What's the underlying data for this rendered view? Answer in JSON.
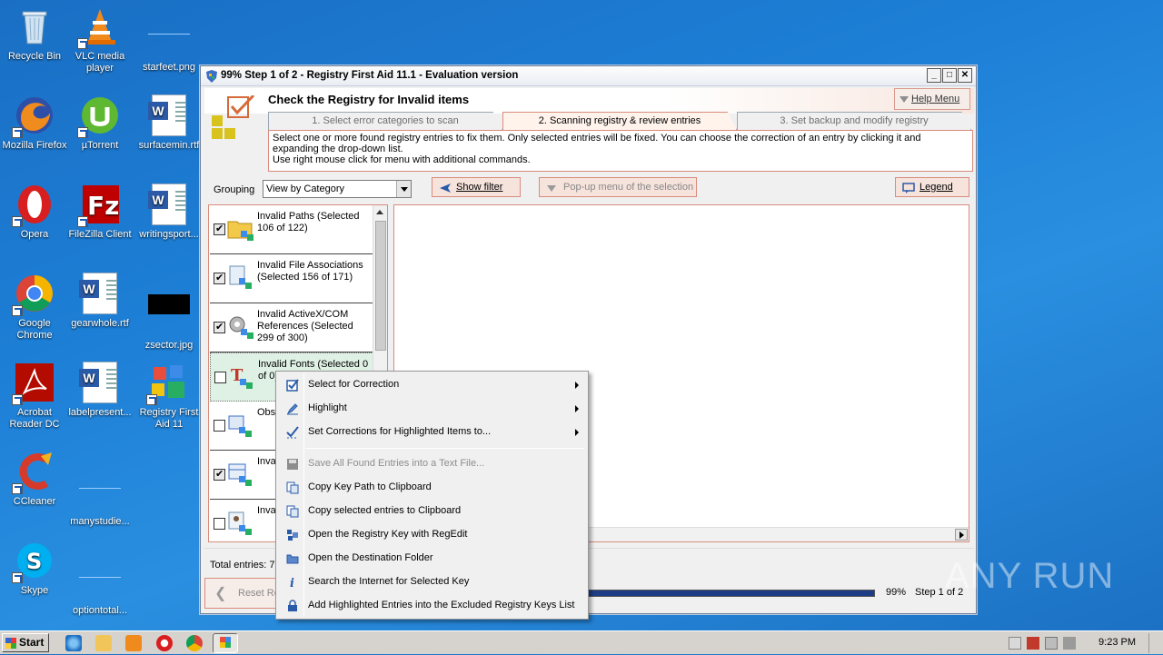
{
  "desktop": {
    "icons": [
      {
        "label": "Recycle Bin"
      },
      {
        "label": "VLC media player"
      },
      {
        "label": "starfeet.png"
      },
      {
        "label": "Mozilla Firefox"
      },
      {
        "label": "µTorrent"
      },
      {
        "label": "surfacemin.rtf"
      },
      {
        "label": "Opera"
      },
      {
        "label": "FileZilla Client"
      },
      {
        "label": "writingsport..."
      },
      {
        "label": "Google Chrome"
      },
      {
        "label": "gearwhole.rtf"
      },
      {
        "label": "zsector.jpg"
      },
      {
        "label": "Acrobat Reader DC"
      },
      {
        "label": "labelpresent..."
      },
      {
        "label": "Registry First Aid 11"
      },
      {
        "label": "CCleaner"
      },
      {
        "label": "manystudie..."
      },
      {
        "label": "Skype"
      },
      {
        "label": "optiontotal..."
      }
    ]
  },
  "window": {
    "title": "99% Step 1 of 2 - Registry First Aid 11.1 - Evaluation version",
    "header_title": "Check the Registry for Invalid items",
    "help_menu": "Help Menu",
    "tabs": [
      {
        "label": "1. Select error categories to scan"
      },
      {
        "label": "2. Scanning registry & review entries"
      },
      {
        "label": "3. Set backup and modify registry"
      }
    ],
    "info_line1": "Select one or more found registry entries to fix them. Only selected entries will be fixed. You can choose the correction of an entry by clicking it and expanding the drop-down list.",
    "info_line2": "Use right mouse click for menu with additional commands.",
    "grouping_label": "Grouping",
    "grouping_value": "View by Category",
    "show_filter": "Show filter",
    "popup_menu": "Pop-up menu of the selection",
    "legend": "Legend",
    "categories": [
      {
        "label": "Invalid Paths (Selected 106 of 122)",
        "checked": true
      },
      {
        "label": "Invalid File Associations (Selected 156 of 171)",
        "checked": true
      },
      {
        "label": "Invalid ActiveX/COM References (Selected 299 of 300)",
        "checked": true
      },
      {
        "label": "Invalid Fonts (Selected 0 of 0)",
        "checked": false
      },
      {
        "label": "Obs Item",
        "checked": false
      },
      {
        "label": "Inva (Sel",
        "checked": true
      },
      {
        "label": "Inva (Sel",
        "checked": false
      }
    ],
    "total_entries": "Total entries: 7",
    "reset_button": "Reset Re",
    "progress_percent": "99%",
    "progress_fraction": 0.99,
    "step_text": "Step 1 of 2"
  },
  "context_menu": {
    "items": [
      {
        "label": "Select for Correction",
        "submenu": true,
        "enabled": true,
        "icon": "checkbox-icon"
      },
      {
        "label": "Highlight",
        "submenu": true,
        "enabled": true,
        "icon": "highlight-pen-icon"
      },
      {
        "label": "Set Corrections for Highlighted Items to...",
        "submenu": true,
        "enabled": true,
        "icon": "check-dotted-icon"
      },
      {
        "label": "Save All Found Entries into a Text File...",
        "submenu": false,
        "enabled": false,
        "icon": "save-icon"
      },
      {
        "label": "Copy Key Path to Clipboard",
        "submenu": false,
        "enabled": true,
        "icon": "copy-icon"
      },
      {
        "label": "Copy selected entries to Clipboard",
        "submenu": false,
        "enabled": true,
        "icon": "copy-icon"
      },
      {
        "label": "Open the Registry Key with RegEdit",
        "submenu": false,
        "enabled": true,
        "icon": "regedit-icon"
      },
      {
        "label": "Open the Destination Folder",
        "submenu": false,
        "enabled": true,
        "icon": "folder-icon"
      },
      {
        "label": "Search the Internet for Selected Key",
        "submenu": false,
        "enabled": true,
        "icon": "info-icon"
      },
      {
        "label": "Add Highlighted Entries into the Excluded Registry Keys List",
        "submenu": false,
        "enabled": true,
        "icon": "lock-icon"
      }
    ]
  },
  "watermark": "ANY RUN",
  "taskbar": {
    "start": "Start",
    "clock": "9:23 PM"
  },
  "colors": {
    "desktop": "#1d7fd6",
    "accent_border": "#d88c7c",
    "progress": "#1e3d86"
  }
}
